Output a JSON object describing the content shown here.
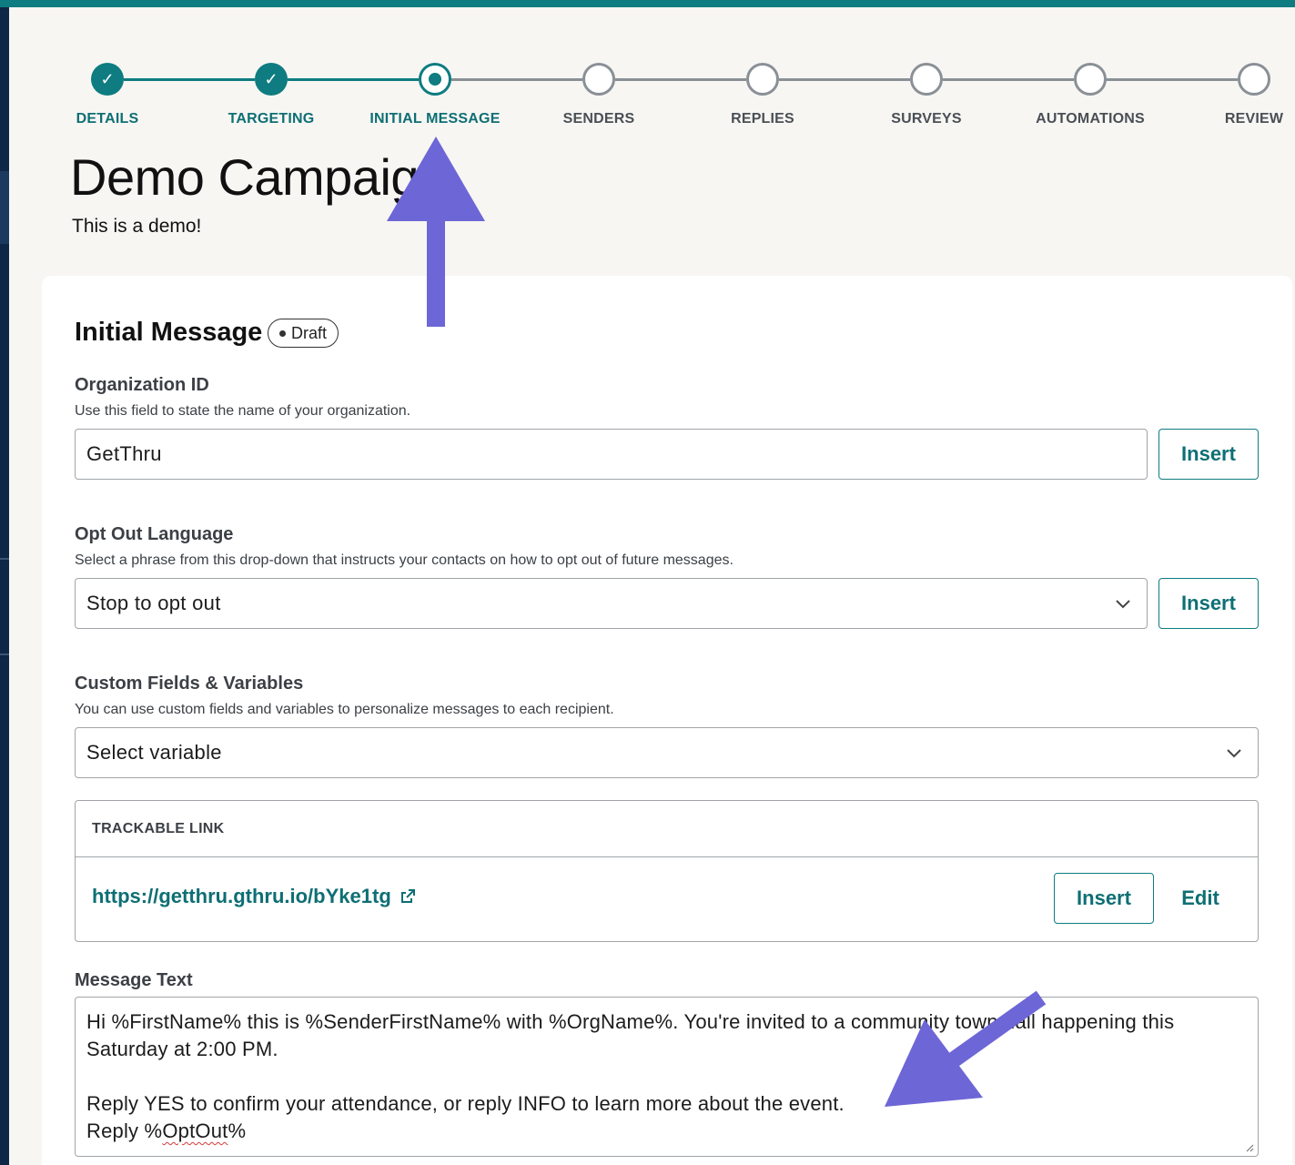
{
  "stepper": {
    "steps": [
      {
        "label": "DETAILS",
        "state": "done"
      },
      {
        "label": "TARGETING",
        "state": "done"
      },
      {
        "label": "INITIAL MESSAGE",
        "state": "current"
      },
      {
        "label": "SENDERS",
        "state": "todo"
      },
      {
        "label": "REPLIES",
        "state": "todo"
      },
      {
        "label": "SURVEYS",
        "state": "todo"
      },
      {
        "label": "AUTOMATIONS",
        "state": "todo"
      },
      {
        "label": "REVIEW",
        "state": "todo"
      }
    ],
    "check_glyph": "✓"
  },
  "page": {
    "title": "Demo Campaign",
    "subtitle": "This is a demo!"
  },
  "section": {
    "title": "Initial Message",
    "badge": "Draft"
  },
  "org_id": {
    "label": "Organization ID",
    "help": "Use this field to state the name of your organization.",
    "value": "GetThru",
    "insert_label": "Insert"
  },
  "opt_out": {
    "label": "Opt Out Language",
    "help": "Select a phrase from this drop-down that instructs your contacts on how to opt out of future messages.",
    "value": "Stop to opt out",
    "insert_label": "Insert"
  },
  "custom_fields": {
    "label": "Custom Fields & Variables",
    "help": "You can use custom fields and variables to personalize messages to each recipient.",
    "value": "Select variable"
  },
  "trackable_link": {
    "header": "TRACKABLE LINK",
    "url": "https://getthru.gthru.io/bYke1tg",
    "insert_label": "Insert",
    "edit_label": "Edit"
  },
  "message": {
    "label": "Message Text",
    "line1": "Hi %FirstName% this is %SenderFirstName% with %OrgName%. You're invited to a community town hall happening this Saturday at 2:00 PM.",
    "line2": "Reply YES to confirm your attendance, or reply INFO to learn more about the event.",
    "line3_prefix": "Reply %",
    "line3_misspelled": "OptOut",
    "line3_suffix": "%"
  },
  "colors": {
    "accent": "#0e7c80",
    "annotation_arrow": "#6d66d6",
    "sidebar": "#0f2747"
  },
  "icons": {
    "external_link": "external-link-icon",
    "dropdown": "chevron-down-icon",
    "check": "check-icon",
    "resize": "resize-grip-icon"
  }
}
